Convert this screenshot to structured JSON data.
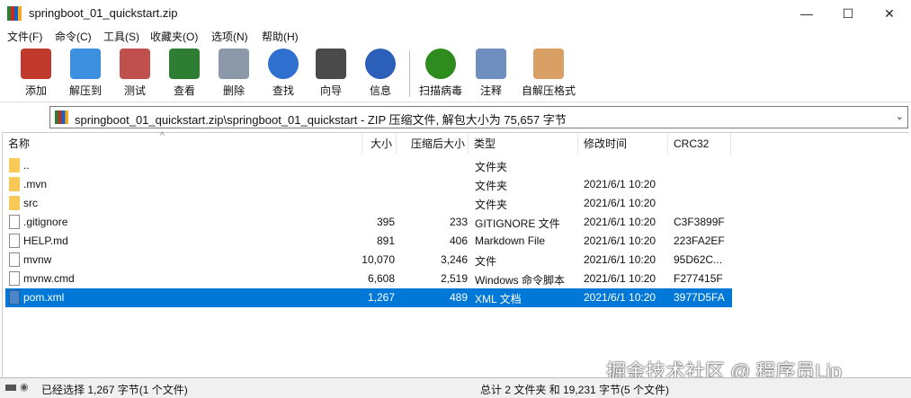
{
  "window": {
    "title": "springboot_01_quickstart.zip"
  },
  "menu": [
    "文件(F)",
    "命令(C)",
    "工具(S)",
    "收藏夹(O)",
    "选项(N)",
    "帮助(H)"
  ],
  "toolbar": [
    {
      "label": "添加",
      "icon": "add-icon",
      "color": "#c0392b"
    },
    {
      "label": "解压到",
      "icon": "extract-folder-icon",
      "color": "#3d8fe0"
    },
    {
      "label": "测试",
      "icon": "test-clipboard-icon",
      "color": "#c0504d"
    },
    {
      "label": "查看",
      "icon": "view-book-icon",
      "color": "#2e7d32"
    },
    {
      "label": "删除",
      "icon": "trash-icon",
      "color": "#8a98a8"
    },
    {
      "label": "查找",
      "icon": "search-icon",
      "color": "#2f6fcf"
    },
    {
      "label": "向导",
      "icon": "wizard-wand-icon",
      "color": "#4a4a4a"
    },
    {
      "label": "信息",
      "icon": "info-icon",
      "color": "#2b5fb8"
    },
    {
      "label": "扫描病毒",
      "icon": "virus-scan-icon",
      "color": "#2e8b1e"
    },
    {
      "label": "注释",
      "icon": "comment-icon",
      "color": "#6f8fbf"
    },
    {
      "label": "自解压格式",
      "icon": "sfx-box-icon",
      "color": "#d9a066"
    }
  ],
  "address": {
    "path": "springboot_01_quickstart.zip\\springboot_01_quickstart - ZIP 压缩文件, 解包大小为 75,657 字节"
  },
  "columns": {
    "name": "名称",
    "size": "大小",
    "packed": "压缩后大小",
    "type": "类型",
    "modified": "修改时间",
    "crc": "CRC32"
  },
  "files": [
    {
      "name": "..",
      "size": "",
      "packed": "",
      "type": "文件夹",
      "modified": "",
      "crc": "",
      "kind": "folder"
    },
    {
      "name": ".mvn",
      "size": "",
      "packed": "",
      "type": "文件夹",
      "modified": "2021/6/1 10:20",
      "crc": "",
      "kind": "folder"
    },
    {
      "name": "src",
      "size": "",
      "packed": "",
      "type": "文件夹",
      "modified": "2021/6/1 10:20",
      "crc": "",
      "kind": "folder"
    },
    {
      "name": ".gitignore",
      "size": "395",
      "packed": "233",
      "type": "GITIGNORE 文件",
      "modified": "2021/6/1 10:20",
      "crc": "C3F3899F",
      "kind": "file"
    },
    {
      "name": "HELP.md",
      "size": "891",
      "packed": "406",
      "type": "Markdown File",
      "modified": "2021/6/1 10:20",
      "crc": "223FA2EF",
      "kind": "file"
    },
    {
      "name": "mvnw",
      "size": "10,070",
      "packed": "3,246",
      "type": "文件",
      "modified": "2021/6/1 10:20",
      "crc": "95D62C...",
      "kind": "file"
    },
    {
      "name": "mvnw.cmd",
      "size": "6,608",
      "packed": "2,519",
      "type": "Windows 命令脚本",
      "modified": "2021/6/1 10:20",
      "crc": "F277415F",
      "kind": "file"
    },
    {
      "name": "pom.xml",
      "size": "1,267",
      "packed": "489",
      "type": "XML 文档",
      "modified": "2021/6/1 10:20",
      "crc": "3977D5FA",
      "kind": "xml",
      "selected": true
    }
  ],
  "status": {
    "left": "已经选择 1,267 字节(1 个文件)",
    "right": "总计 2 文件夹 和 19,231 字节(5 个文件)"
  },
  "watermark": "掘金技术社区 @ 程序员Lip"
}
